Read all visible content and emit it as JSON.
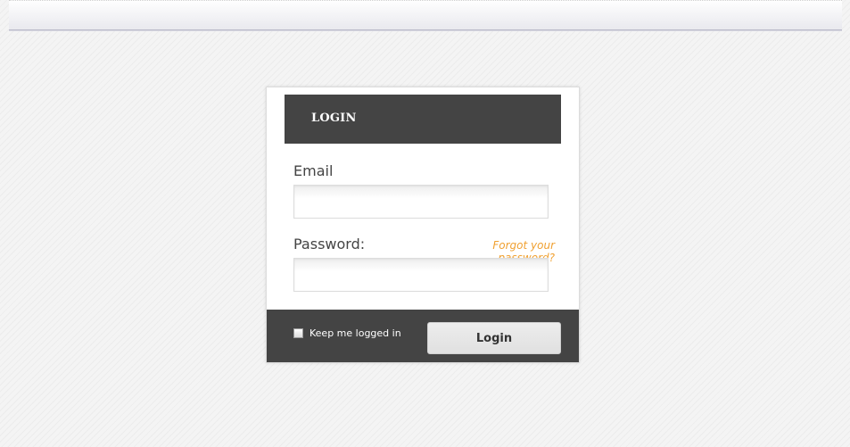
{
  "header": {
    "title": "LOGIN"
  },
  "form": {
    "email_label": "Email",
    "email_value": "",
    "email_placeholder": "",
    "password_label": "Password:",
    "password_value": "",
    "password_placeholder": "",
    "forgot_link": "Forgot your password?",
    "remember_label": "Keep me logged in",
    "remember_checked": false,
    "submit_label": "Login"
  },
  "colors": {
    "header_bg": "#444444",
    "link": "#f0a030",
    "button_bg": "#e6e6e6"
  }
}
